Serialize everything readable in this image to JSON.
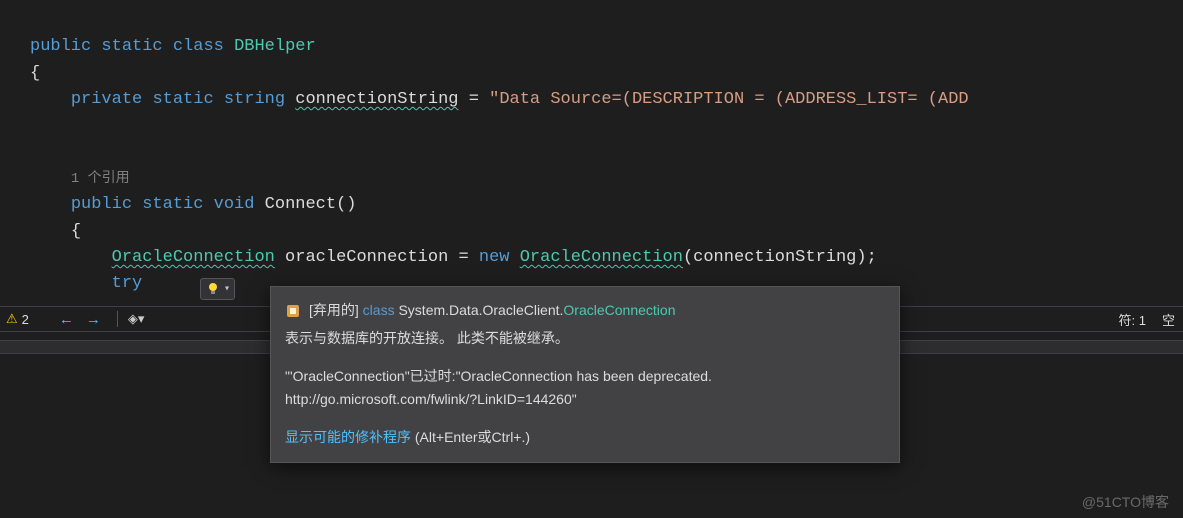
{
  "code": {
    "line1_kw1": "public",
    "line1_kw2": "static",
    "line1_kw3": "class",
    "line1_type": "DBHelper",
    "line2_brace": "{",
    "line3_kw1": "private",
    "line3_kw2": "static",
    "line3_kw3": "string",
    "line3_ident": "connectionString",
    "line3_eq": " = ",
    "line3_str": "\"Data Source=(DESCRIPTION = (ADDRESS_LIST= (ADD",
    "codelens": "1 个引用",
    "line5_kw1": "public",
    "line5_kw2": "static",
    "line5_kw3": "void",
    "line5_method": "Connect",
    "line5_paren": "()",
    "line6_brace": "{",
    "line7_type1": "OracleConnection",
    "line7_ident": " oracleConnection = ",
    "line7_kw": "new",
    "line7_type2": "OracleConnection",
    "line7_tail": "(connectionString);",
    "line8_kw": "try"
  },
  "statusbar": {
    "warning_count": "2",
    "char_label": "符: 1",
    "space_label": "空"
  },
  "tooltip": {
    "deprecated_tag": "[弃用的]",
    "class_kw": "class",
    "namespace": "System.Data.OracleClient.",
    "classname": "OracleConnection",
    "description": "表示与数据库的开放连接。 此类不能被继承。",
    "message": "\"'OracleConnection\"已过时:\"OracleConnection has been deprecated. http://go.microsoft.com/fwlink/?LinkID=144260\"",
    "fix_link": "显示可能的修补程序",
    "fix_shortcut": " (Alt+Enter或Ctrl+.)"
  },
  "watermark": "@51CTO博客"
}
